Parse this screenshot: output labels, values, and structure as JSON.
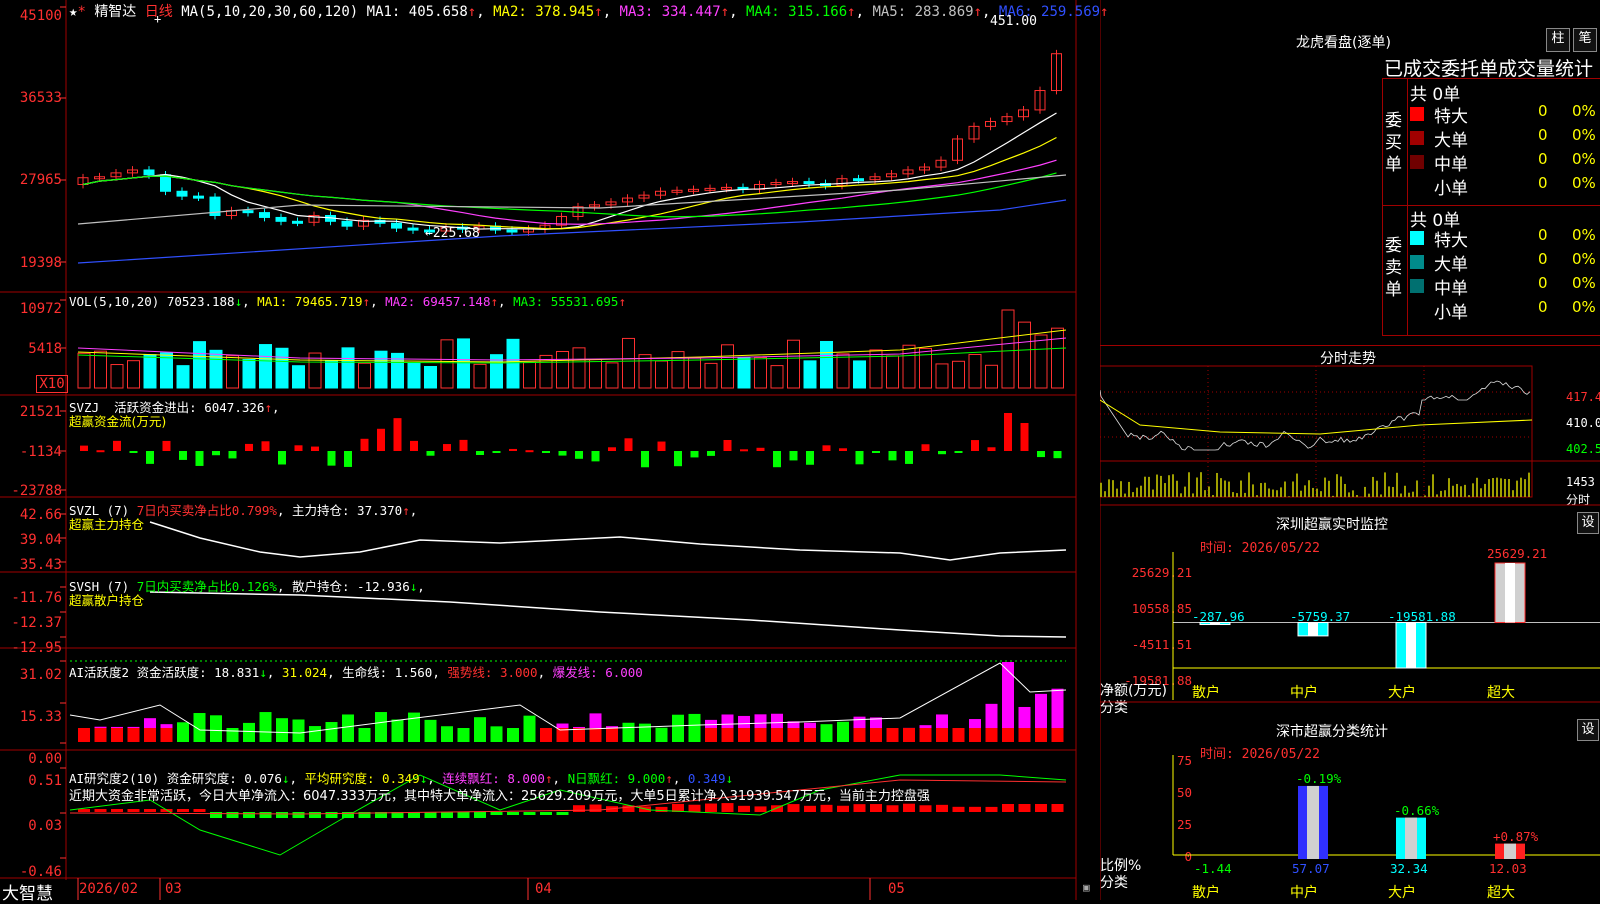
{
  "toolbar": {
    "star_icon": "star-icon",
    "stock_name": "精智达",
    "period": "日线",
    "cross_icon": "crosshair-icon"
  },
  "main_chart": {
    "ma_header": "MA(5,10,20,30,60,120)",
    "ma1": "MA1: 405.658",
    "ma2": "MA2: 378.945",
    "ma3": "MA3: 334.447",
    "ma4": "MA4: 315.166",
    "ma5": "MA5: 283.869",
    "ma6": "MA6: 259.569",
    "high_label": "451.00",
    "low_label": "225.68",
    "low_arrow": "←",
    "yticks": [
      "45100",
      "36533",
      "27965",
      "19398"
    ],
    "colors": {
      "ma1": "#ffffff",
      "ma2": "#ffff00",
      "ma3": "#ff40ff",
      "ma4": "#00ff00",
      "ma5": "#c0c0c0",
      "ma6": "#3050ff"
    }
  },
  "vol_panel": {
    "header": "VOL(5,10,20)",
    "value": "70523.188",
    "ma1": "MA1: 79465.719",
    "ma2": "MA2: 69457.148",
    "ma3": "MA3: 55531.695",
    "yticks": [
      "10972",
      "5418"
    ],
    "unit": "X10"
  },
  "svzj_panel": {
    "header": "SVZJ",
    "label": "活跃资金进出: 6047.326",
    "subtitle": "超赢资金流(万元)",
    "yticks": [
      "21521",
      "-1134",
      "-23788"
    ]
  },
  "svzl_panel": {
    "header": "SVZL (7)",
    "ratio": "7日内买卖净占比0.799%",
    "hold": "主力持仓: 37.370",
    "subtitle": "超赢主力持仓",
    "yticks": [
      "42.66",
      "39.04",
      "35.43"
    ]
  },
  "svsh_panel": {
    "header": "SVSH (7)",
    "ratio": "7日内买卖净占比0.126%",
    "hold": "散户持仓: -12.936",
    "subtitle": "超赢散户持仓",
    "yticks": [
      "-11.76",
      "-12.37",
      "-12.95"
    ]
  },
  "ai_active_panel": {
    "header": "AI活跃度2",
    "v1": "资金活跃度: 18.831",
    "v2": "31.024",
    "v3": "生命线: 1.560",
    "v4": "强势线: 3.000",
    "v5": "爆发线: 6.000",
    "yticks": [
      "31.02",
      "15.33",
      "0.00"
    ]
  },
  "ai_research_panel": {
    "header": "AI研究度2(10)",
    "v1": "资金研究度: 0.076",
    "v2": "平均研究度: 0.349",
    "v3": "连续飘红: 8.000",
    "v4": "N日飘红: 9.000",
    "v5": "0.349",
    "commentary": "近期大资金非常活跃，今日大单净流入：6047.333万元，其中特大单净流入：25629.209万元，大单5日累计净入31939.547万元，当前主力控盘强",
    "yticks": [
      "0.51",
      "0.03",
      "-0.46"
    ]
  },
  "footer": {
    "brand": "大智慧",
    "dates": [
      "2026/02",
      "03",
      "04",
      "05"
    ],
    "lock_icon": "lock-icon"
  },
  "dragon_tiger": {
    "title": "龙虎看盘(逐单)",
    "btn_col": "柱",
    "btn_pen": "笔",
    "tabs": "已成交委托单成交量统计",
    "buy_label": "委买单",
    "sell_label": "委卖单",
    "buy_total": "共 0单",
    "sell_total": "共 0单",
    "buy_rows": [
      {
        "name": "特大",
        "count": "0",
        "pct": "0%",
        "color": "#ff0000"
      },
      {
        "name": "大单",
        "count": "0",
        "pct": "0%",
        "color": "#a00000"
      },
      {
        "name": "中单",
        "count": "0",
        "pct": "0%",
        "color": "#700000"
      },
      {
        "name": "小单",
        "count": "0",
        "pct": "0%",
        "color": "#000000"
      }
    ],
    "sell_rows": [
      {
        "name": "特大",
        "count": "0",
        "pct": "0%",
        "color": "#00ffff"
      },
      {
        "name": "大单",
        "count": "0",
        "pct": "0%",
        "color": "#008b8b"
      },
      {
        "name": "中单",
        "count": "0",
        "pct": "0%",
        "color": "#007070"
      },
      {
        "name": "小单",
        "count": "0",
        "pct": "0%",
        "color": "#000000"
      }
    ]
  },
  "intraday": {
    "title": "分时走势",
    "yticks": [
      "417.4",
      "410.0",
      "402.5"
    ],
    "vol_tick": "1453",
    "vol_unit": "分时"
  },
  "sz_monitor": {
    "title": "深圳超赢实时监控",
    "settings": "设",
    "time": "时间: 2026/05/22",
    "yticks": [
      "25629.21",
      "10558.85",
      "-4511.51",
      "-19581.88"
    ],
    "axis_title": "净额(万元)",
    "axis_sub": "分类",
    "categories": [
      "散户",
      "中户",
      "大户",
      "超大"
    ],
    "values": [
      -287.96,
      -5759.37,
      -19581.88,
      25629.21
    ],
    "value_labels": [
      "-287.96",
      "-5759.37",
      "-19581.88",
      "25629.21"
    ]
  },
  "sz_classify": {
    "title": "深市超赢分类统计",
    "settings": "设",
    "time": "时间: 2026/05/22",
    "yticks": [
      "75",
      "50",
      "25",
      "0"
    ],
    "axis_title": "比例%",
    "axis_sub": "分类",
    "categories": [
      "散户",
      "中户",
      "大户",
      "超大"
    ],
    "values": [
      -1.44,
      57.07,
      32.34,
      12.03
    ],
    "changes": [
      "",
      "-0.19%",
      "-0.66%",
      "+0.87%"
    ],
    "value_labels": [
      "-1.44",
      "57.07",
      "32.34",
      "12.03"
    ]
  }
}
